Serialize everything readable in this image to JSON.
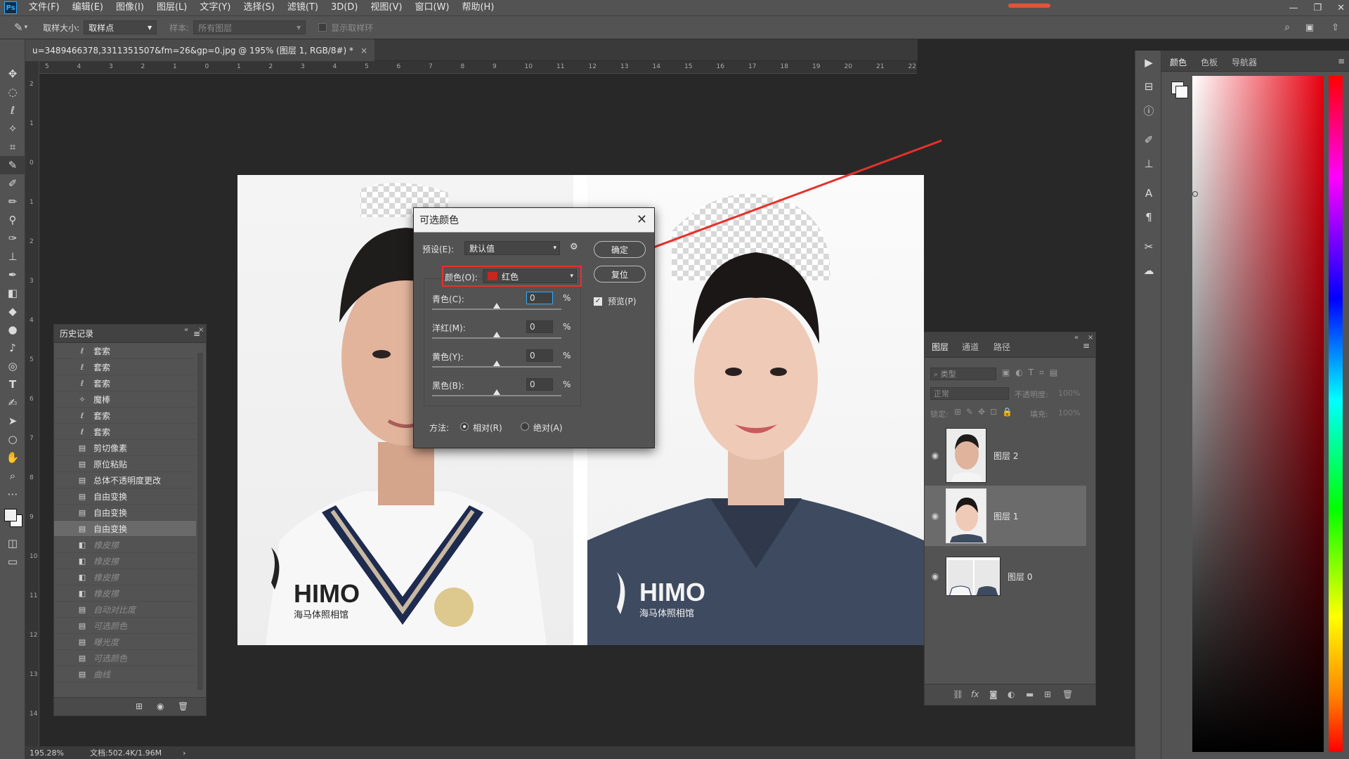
{
  "menubar": {
    "logo": "Ps",
    "items": [
      "文件(F)",
      "编辑(E)",
      "图像(I)",
      "图层(L)",
      "文字(Y)",
      "选择(S)",
      "滤镜(T)",
      "3D(D)",
      "视图(V)",
      "窗口(W)",
      "帮助(H)"
    ]
  },
  "options": {
    "sample_size_label": "取样大小:",
    "sample_size_value": "取样点",
    "sample_label": "样本:",
    "sample_value": "所有图层",
    "show_ring_label": "显示取样环"
  },
  "document": {
    "tab_title": "u=3489466378,3311351507&fm=26&gp=0.jpg @ 195% (图层 1, RGB/8#) *"
  },
  "rulers": {
    "horizontal": [
      "5",
      "4",
      "3",
      "2",
      "1",
      "0",
      "1",
      "2",
      "3",
      "4",
      "5",
      "6",
      "7",
      "8",
      "9",
      "10",
      "11",
      "12",
      "13",
      "14",
      "15",
      "16",
      "17",
      "18",
      "19",
      "20",
      "21",
      "22"
    ],
    "vertical": [
      "2",
      "1",
      "0",
      "1",
      "2",
      "3",
      "4",
      "5",
      "6",
      "7",
      "8",
      "9",
      "10",
      "11",
      "12",
      "13",
      "14"
    ]
  },
  "canvas": {
    "left_logo": "HIMO",
    "left_logo_sub": "海马体照相馆",
    "right_logo": "HIMO",
    "right_logo_sub": "海马体照相馆"
  },
  "dialog": {
    "title": "可选颜色",
    "preset_label": "预设(E):",
    "preset_value": "默认值",
    "color_label": "颜色(O):",
    "color_value": "红色",
    "color_swatch": "#c8261e",
    "ok_label": "确定",
    "reset_label": "复位",
    "preview_label": "预览(P)",
    "preview_checked": true,
    "sliders": [
      {
        "label": "青色(C):",
        "value": "0",
        "unit": "%"
      },
      {
        "label": "洋红(M):",
        "value": "0",
        "unit": "%"
      },
      {
        "label": "黄色(Y):",
        "value": "0",
        "unit": "%"
      },
      {
        "label": "黑色(B):",
        "value": "0",
        "unit": "%"
      }
    ],
    "method_label": "方法:",
    "method_relative": "相对(R)",
    "method_absolute": "绝对(A)",
    "method_selected": "relative"
  },
  "history": {
    "title": "历史记录",
    "items": [
      {
        "icon": "lasso-icon",
        "label": "套索",
        "state": "normal"
      },
      {
        "icon": "lasso-icon",
        "label": "套索",
        "state": "normal"
      },
      {
        "icon": "lasso-icon",
        "label": "套索",
        "state": "normal"
      },
      {
        "icon": "magic-wand-icon",
        "label": "魔棒",
        "state": "normal"
      },
      {
        "icon": "lasso-icon",
        "label": "套索",
        "state": "normal"
      },
      {
        "icon": "lasso-icon",
        "label": "套索",
        "state": "normal"
      },
      {
        "icon": "doc-icon",
        "label": "剪切像素",
        "state": "normal"
      },
      {
        "icon": "doc-icon",
        "label": "原位粘贴",
        "state": "normal"
      },
      {
        "icon": "doc-icon",
        "label": "总体不透明度更改",
        "state": "normal"
      },
      {
        "icon": "doc-icon",
        "label": "自由变换",
        "state": "normal"
      },
      {
        "icon": "doc-icon",
        "label": "自由变换",
        "state": "normal"
      },
      {
        "icon": "doc-icon",
        "label": "自由变换",
        "state": "selected"
      },
      {
        "icon": "eraser-icon",
        "label": "橡皮擦",
        "state": "dim"
      },
      {
        "icon": "eraser-icon",
        "label": "橡皮擦",
        "state": "dim"
      },
      {
        "icon": "eraser-icon",
        "label": "橡皮擦",
        "state": "dim"
      },
      {
        "icon": "eraser-icon",
        "label": "橡皮擦",
        "state": "dim"
      },
      {
        "icon": "doc-icon",
        "label": "自动对比度",
        "state": "dim"
      },
      {
        "icon": "doc-icon",
        "label": "可选颜色",
        "state": "dim"
      },
      {
        "icon": "doc-icon",
        "label": "曝光度",
        "state": "dim"
      },
      {
        "icon": "doc-icon",
        "label": "可选颜色",
        "state": "dim"
      },
      {
        "icon": "doc-icon",
        "label": "曲线",
        "state": "dim"
      }
    ]
  },
  "layers": {
    "tabs": [
      "图层",
      "通道",
      "路径"
    ],
    "filter_label": "类型",
    "blend_mode": "正常",
    "opacity_label": "不透明度:",
    "opacity_value": "100%",
    "lock_label": "锁定:",
    "fill_label": "填充:",
    "fill_value": "100%",
    "items": [
      {
        "name": "图层 2",
        "selected": false
      },
      {
        "name": "图层 1",
        "selected": true
      },
      {
        "name": "图层 0",
        "selected": false
      }
    ]
  },
  "colorpanel": {
    "tabs": [
      "颜色",
      "色板",
      "导航器"
    ]
  },
  "status": {
    "zoom": "195.28%",
    "doc_size": "文档:502.4K/1.96M"
  },
  "colors": {
    "annotation_red": "#e8302a",
    "ps_blue": "#31a8ff"
  }
}
